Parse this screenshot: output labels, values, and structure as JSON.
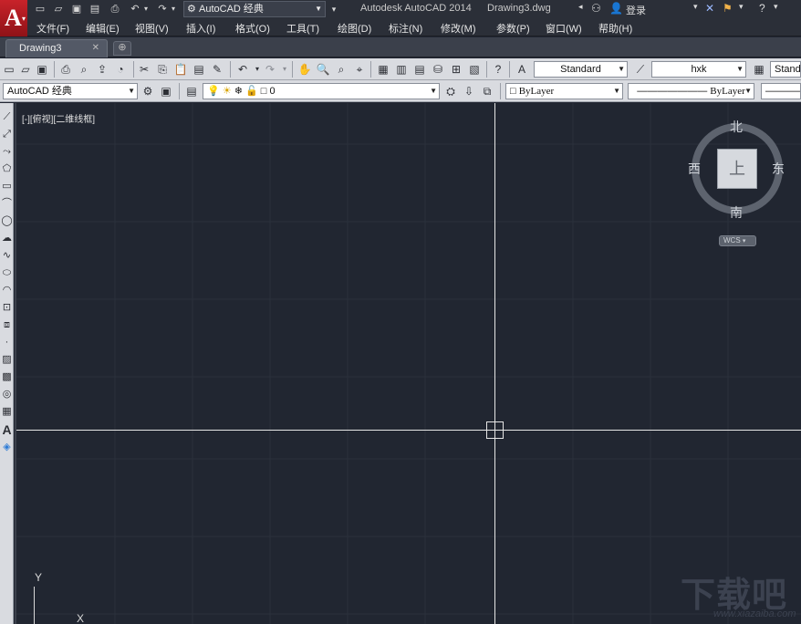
{
  "app": {
    "logo_letter": "A",
    "title": "Autodesk AutoCAD 2014",
    "document": "Drawing3.dwg",
    "workspace": "AutoCAD 经典",
    "login": "登录"
  },
  "menu": [
    "文件(F)",
    "编辑(E)",
    "视图(V)",
    "插入(I)",
    "格式(O)",
    "工具(T)",
    "绘图(D)",
    "标注(N)",
    "修改(M)",
    "参数(P)",
    "窗口(W)",
    "帮助(H)"
  ],
  "tabs": [
    {
      "label": "Drawing3"
    }
  ],
  "toolbar": {
    "text_style": "Standard",
    "dim_style": "hxk",
    "table_style": "Standa",
    "workspace": "AutoCAD 经典",
    "layer": "0",
    "color": "ByLayer",
    "linetype": "ByLayer"
  },
  "viewport": {
    "label": "[-][俯视][二维线框]",
    "ucs_y": "Y",
    "ucs_x": "X"
  },
  "viewcube": {
    "face": "上",
    "north": "北",
    "south": "南",
    "east": "东",
    "west": "西",
    "wcs": "WCS"
  },
  "watermark": {
    "main": "下载吧",
    "url": "www.xiazaiba.com"
  }
}
